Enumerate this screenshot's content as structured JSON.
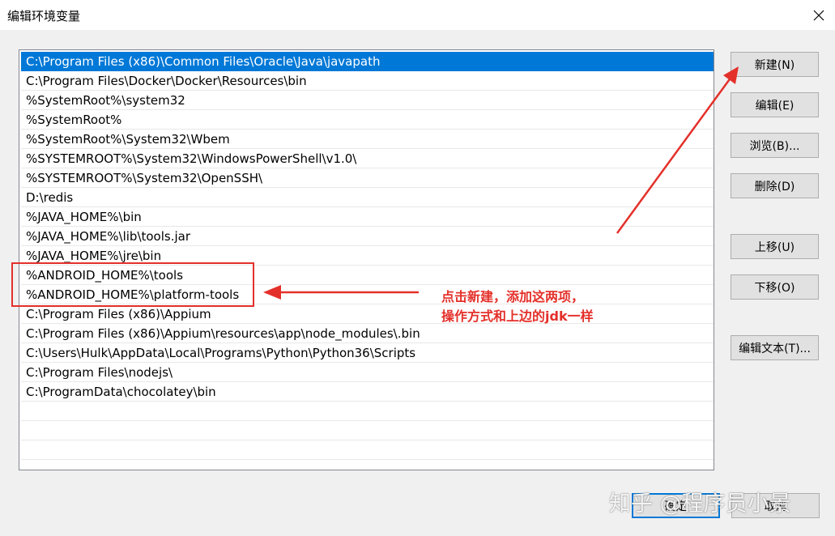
{
  "window": {
    "title": "编辑环境变量",
    "close_icon": "close-icon"
  },
  "path_list": {
    "entries": [
      "C:\\Program Files (x86)\\Common Files\\Oracle\\Java\\javapath",
      "C:\\Program Files\\Docker\\Docker\\Resources\\bin",
      "%SystemRoot%\\system32",
      "%SystemRoot%",
      "%SystemRoot%\\System32\\Wbem",
      "%SYSTEMROOT%\\System32\\WindowsPowerShell\\v1.0\\",
      "%SYSTEMROOT%\\System32\\OpenSSH\\",
      "D:\\redis",
      "%JAVA_HOME%\\bin",
      "%JAVA_HOME%\\lib\\tools.jar",
      "%JAVA_HOME%\\jre\\bin",
      "%ANDROID_HOME%\\tools",
      "%ANDROID_HOME%\\platform-tools",
      "C:\\Program Files (x86)\\Appium",
      "C:\\Program Files (x86)\\Appium\\resources\\app\\node_modules\\.bin",
      "C:\\Users\\Hulk\\AppData\\Local\\Programs\\Python\\Python36\\Scripts",
      "C:\\Program Files\\nodejs\\",
      "C:\\ProgramData\\chocolatey\\bin"
    ],
    "selected_index": 0
  },
  "buttons": {
    "new": "新建(N)",
    "edit": "编辑(E)",
    "browse": "浏览(B)...",
    "delete": "删除(D)",
    "move_up": "上移(U)",
    "move_down": "下移(O)",
    "edit_text": "编辑文本(T)...",
    "ok": "确定",
    "cancel": "取消"
  },
  "annotation": {
    "line1": "点击新建，添加这两项，",
    "line2": "操作方式和上边的jdk一样",
    "color": "#e4302a"
  },
  "watermark": "知乎 @程序员小景",
  "colors": {
    "selection": "#0078d7",
    "annotation": "#e4302a"
  }
}
